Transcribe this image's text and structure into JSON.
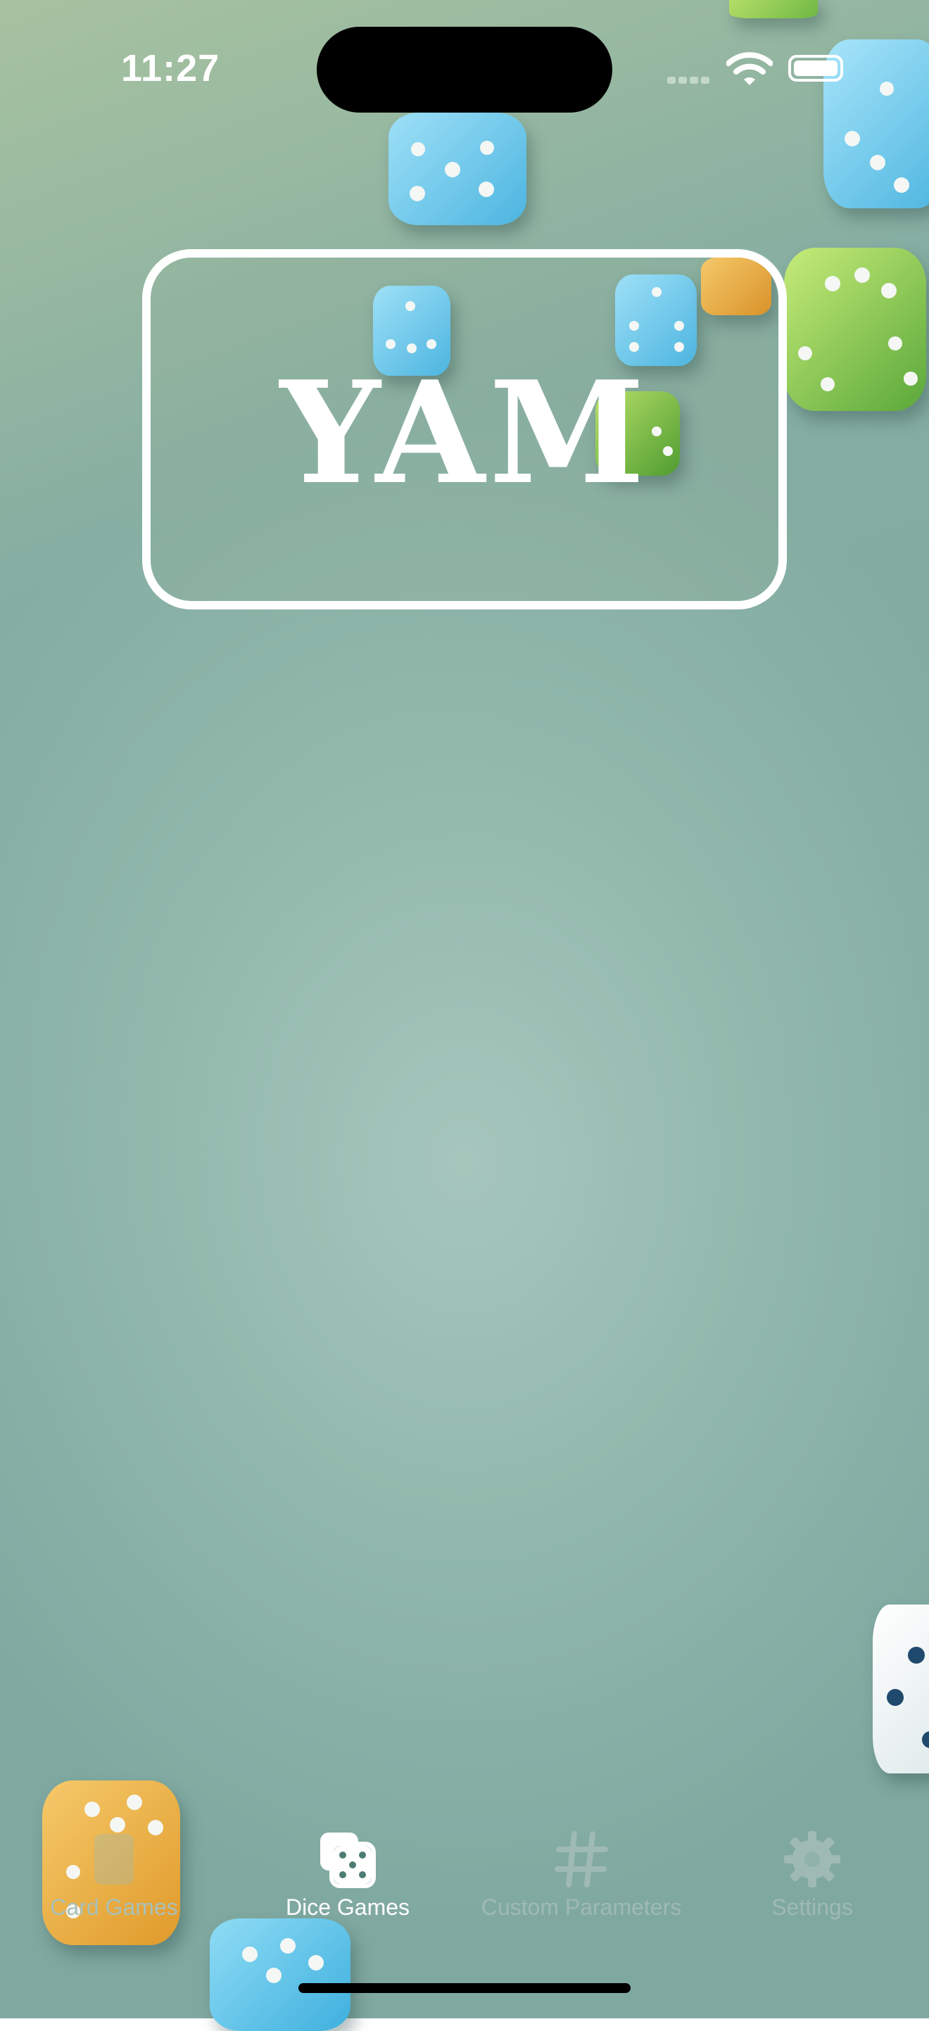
{
  "status_bar": {
    "time": "11:27"
  },
  "title_card": {
    "title": "YAM"
  },
  "tab_bar": {
    "tabs": [
      {
        "label": "Card Games",
        "icon": "card-games-icon",
        "selected": false
      },
      {
        "label": "Dice Games",
        "icon": "dice-icon",
        "selected": true
      },
      {
        "label": "Custom Parameters",
        "icon": "hashtag-icon",
        "selected": false
      },
      {
        "label": "Settings",
        "icon": "gear-icon",
        "selected": false
      }
    ]
  },
  "colors": {
    "selected_tab": "#ffffff",
    "unselected_tab": "#9fbab4",
    "die_blue": "#5fc0e6",
    "die_green": "#7cc148",
    "die_orange": "#e8a83a"
  }
}
